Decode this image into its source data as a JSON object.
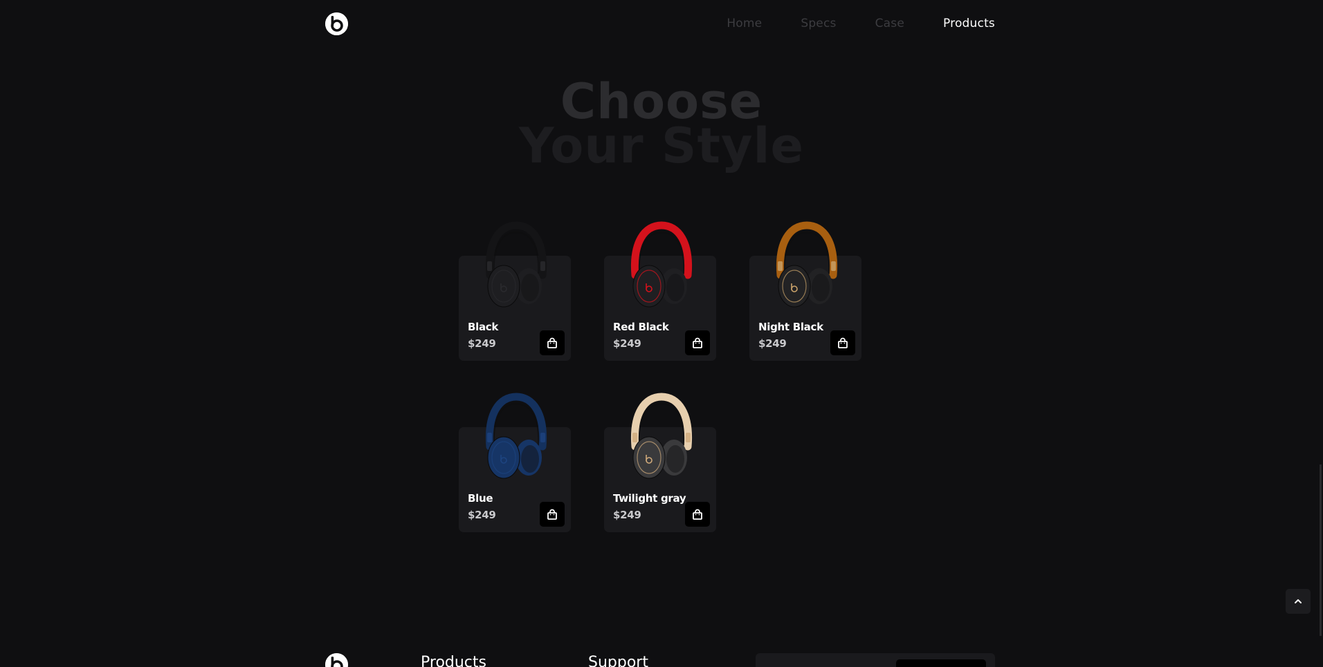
{
  "header": {
    "logo_icon": "beats-logo-icon",
    "nav": [
      {
        "label": "Home",
        "active": false
      },
      {
        "label": "Specs",
        "active": false
      },
      {
        "label": "Case",
        "active": false
      },
      {
        "label": "Products",
        "active": true
      }
    ]
  },
  "hero": {
    "line1": "Choose",
    "line2": "Your Style"
  },
  "products": [
    {
      "name": "Black",
      "price": "$249",
      "band_color": "#141416",
      "cup_color": "#1e1e21",
      "accent": "#2a2a2e"
    },
    {
      "name": "Red Black",
      "price": "$249",
      "band_color": "#d4121c",
      "cup_color": "#1f1f22",
      "accent": "#d4121c"
    },
    {
      "name": "Night Black",
      "price": "$249",
      "band_color": "#a85f10",
      "cup_color": "#222224",
      "accent": "#c9a26a"
    },
    {
      "name": "Blue",
      "price": "$249",
      "band_color": "#14315e",
      "cup_color": "#163566",
      "accent": "#1d4480"
    },
    {
      "name": "Twilight gray",
      "price": "$249",
      "band_color": "#e7cfae",
      "cup_color": "#3a3a3c",
      "accent": "#cfa97a"
    }
  ],
  "cart_icon": "shopping-bag-icon",
  "scroll_top_icon": "chevron-up-icon",
  "footer": {
    "headings": [
      "Products",
      "Support"
    ]
  },
  "colors": {
    "background": "#0f0f11",
    "card": "#1a1a1d",
    "nav_inactive": "#3c3c40",
    "nav_active": "#ffffff"
  }
}
